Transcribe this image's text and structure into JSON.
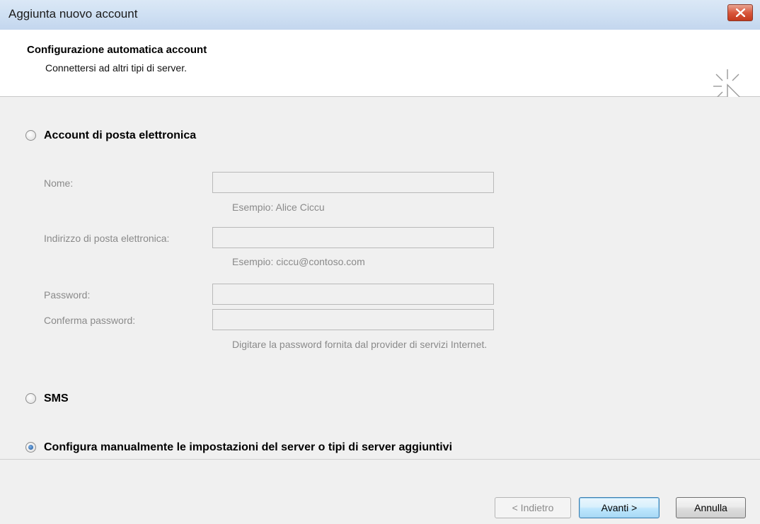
{
  "window": {
    "title": "Aggiunta nuovo account"
  },
  "header": {
    "title": "Configurazione automatica account",
    "subtitle": "Connettersi ad altri tipi di server.",
    "icon": "cursor-sparkle-icon"
  },
  "options": {
    "email_account": {
      "label": "Account di posta elettronica",
      "checked": false
    },
    "sms": {
      "label": "SMS",
      "checked": false
    },
    "manual": {
      "label": "Configura manualmente le impostazioni del server o tipi di server aggiuntivi",
      "checked": true
    }
  },
  "form": {
    "name": {
      "label": "Nome:",
      "value": "",
      "hint": "Esempio: Alice Ciccu"
    },
    "email": {
      "label": "Indirizzo di posta elettronica:",
      "value": "",
      "hint": "Esempio: ciccu@contoso.com"
    },
    "password": {
      "label": "Password:",
      "value": ""
    },
    "confirm_password": {
      "label": "Conferma password:",
      "value": "",
      "hint": "Digitare la password fornita dal provider di servizi Internet."
    }
  },
  "footer": {
    "back_label": "< Indietro",
    "next_label": "Avanti >",
    "cancel_label": "Annulla"
  },
  "colors": {
    "disabled_text": "#8a8a8a",
    "titlebar": "#cfe0f3",
    "close_button": "#d9573c"
  }
}
